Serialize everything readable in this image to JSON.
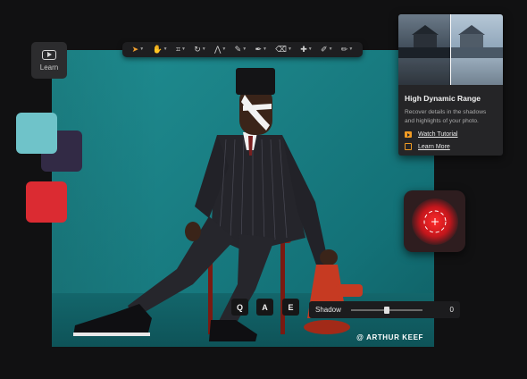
{
  "canvas": {
    "credit": "@ ARTHUR KEEF"
  },
  "toolbar": {
    "tools": [
      {
        "name": "move-tool",
        "glyph": "➤",
        "active": true
      },
      {
        "name": "hand-tool",
        "glyph": "✋",
        "active": false
      },
      {
        "name": "crop-tool",
        "glyph": "⌗",
        "active": false
      },
      {
        "name": "rotate-tool",
        "glyph": "↻",
        "active": false
      },
      {
        "name": "perspective-tool",
        "glyph": "⋀",
        "active": false
      },
      {
        "name": "brush-tool",
        "glyph": "✎",
        "active": false
      },
      {
        "name": "pen-tool",
        "glyph": "✒",
        "active": false
      },
      {
        "name": "eraser-tool",
        "glyph": "⌫",
        "active": false
      },
      {
        "name": "stamp-tool",
        "glyph": "✚",
        "active": false
      },
      {
        "name": "pipette-tool",
        "glyph": "✐",
        "active": false
      },
      {
        "name": "pencil-tool",
        "glyph": "✏",
        "active": false
      }
    ]
  },
  "learn_button": {
    "label": "Learn",
    "icon": "play-icon"
  },
  "swatches": [
    {
      "name": "teal",
      "color": "#6fc3c9"
    },
    {
      "name": "purple",
      "color": "#322a45"
    },
    {
      "name": "red",
      "color": "#db2b32"
    }
  ],
  "hdr_panel": {
    "title": "High Dynamic Range",
    "description": "Recover details in the shadows and highlights of your photo.",
    "watch_tutorial": "Watch Tutorial",
    "learn_more": "Learn More",
    "accent_color": "#f09b24"
  },
  "hotkeys": [
    "Q",
    "A",
    "E"
  ],
  "shadow_slider": {
    "label": "Shadow",
    "value": "0",
    "position": 0.5
  }
}
